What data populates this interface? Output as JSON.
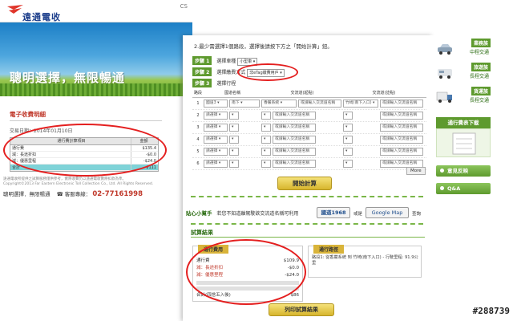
{
  "back_page": {
    "logo_text": "遠通電收",
    "corner_label": "CS",
    "hero_title": "聰明選擇，無限暢通",
    "section_title": "電子收費明細",
    "date_line": "交易日期：2014年01月10日",
    "table_headers": [
      "通行費計算項目",
      "金額"
    ],
    "table_rows": [
      {
        "label": "通行費",
        "value": "$135.4"
      },
      {
        "label": "減：長途折扣",
        "value": "-$0.0"
      },
      {
        "label": "減：優惠里程",
        "value": "-$24.0"
      },
      {
        "label": "合計",
        "value": "$111"
      }
    ],
    "notes": "遠通電收所提供之試算服務僅供參考，實際收費仍以遠通電收實際扣款為準。",
    "copyright": "Copyright©2013 Far Eastern Electronic Toll Collection Co., Ltd. All Rights Reserved.",
    "footer_slogan": "聰明選擇．無限暢通",
    "footer_service": "客服專線：",
    "footer_hotline": "02-77161998"
  },
  "front_page": {
    "instructions": "2.最少需選擇1個路段，選擇後請按下方之「開始計算」鈕。",
    "step1": {
      "badge": "步驟 1",
      "label": "選擇車種",
      "value": "小型車"
    },
    "step2": {
      "badge": "步驟 2",
      "label": "選擇繳費方式",
      "value": "非eTag繳費用戶"
    },
    "step3": {
      "badge": "步驟 3",
      "label": "選擇行程"
    },
    "table_headers": {
      "segment": "路段",
      "road": "國道名稱",
      "entry": "交流道(起點)",
      "exit": "交流道(訖點)"
    },
    "rows": [
      {
        "num": "1",
        "road": "國道3",
        "dir": "南下",
        "entry": "香嚴系統",
        "entry_text": "或請輸入交流道名稱",
        "exit": "竹崎(南下入口)",
        "exit_text": "或請輸入交流道名稱"
      },
      {
        "num": "2",
        "road": "請選擇",
        "dir": "",
        "entry": "",
        "entry_text": "或請輸入交流道名稱",
        "exit": "",
        "exit_text": "或請輸入交流道名稱"
      },
      {
        "num": "3",
        "road": "請選擇",
        "dir": "",
        "entry": "",
        "entry_text": "或請輸入交流道名稱",
        "exit": "",
        "exit_text": "或請輸入交流道名稱"
      },
      {
        "num": "4",
        "road": "請選擇",
        "dir": "",
        "entry": "",
        "entry_text": "或請輸入交流道名稱",
        "exit": "",
        "exit_text": "或請輸入交流道名稱"
      },
      {
        "num": "5",
        "road": "請選擇",
        "dir": "",
        "entry": "",
        "entry_text": "或請輸入交流道名稱",
        "exit": "",
        "exit_text": "或請輸入交流道名稱"
      },
      {
        "num": "6",
        "road": "請選擇",
        "dir": "",
        "entry": "",
        "entry_text": "或請輸入交流道名稱",
        "exit": "",
        "exit_text": "或請輸入交流道名稱"
      }
    ],
    "more_label": "More",
    "calc_button": "開始計算",
    "tips_title": "貼心小幫手",
    "tips_text": "若您不知道離駕駛欲交流道名稱可利用",
    "btn_1968": "國道1968",
    "or_text": "或是",
    "btn_gmap": "Google Map",
    "tips_suffix": "查詢",
    "result_title": "試算結果",
    "fee_tab": "通行費用",
    "fee_rows": [
      {
        "label": "通行費",
        "value": "$109.9",
        "red": false
      },
      {
        "label": "減：長途折扣",
        "value": "-$0.0",
        "red": true
      },
      {
        "label": "減：優惠里程",
        "value": "-$24.0",
        "red": true
      }
    ],
    "fee_total_label": "合計(四捨五入後)",
    "fee_total_value": "$86",
    "route_tab": "通行路徑",
    "route_text": "路段1: 從香嚴系統 到 竹崎(南下入口) - 行駛里程: 91.9公里",
    "print_button": "列印試算結果"
  },
  "side": {
    "cards": [
      {
        "tag": "業務族",
        "sub": "中程交通"
      },
      {
        "tag": "旅遊族",
        "sub": "長程交通"
      },
      {
        "tag": "貨運族",
        "sub": "長程交通"
      }
    ],
    "fee_download": "通行費表下載",
    "feedback": "意見反映",
    "qa": "Q&A"
  },
  "watermark": "#288739"
}
